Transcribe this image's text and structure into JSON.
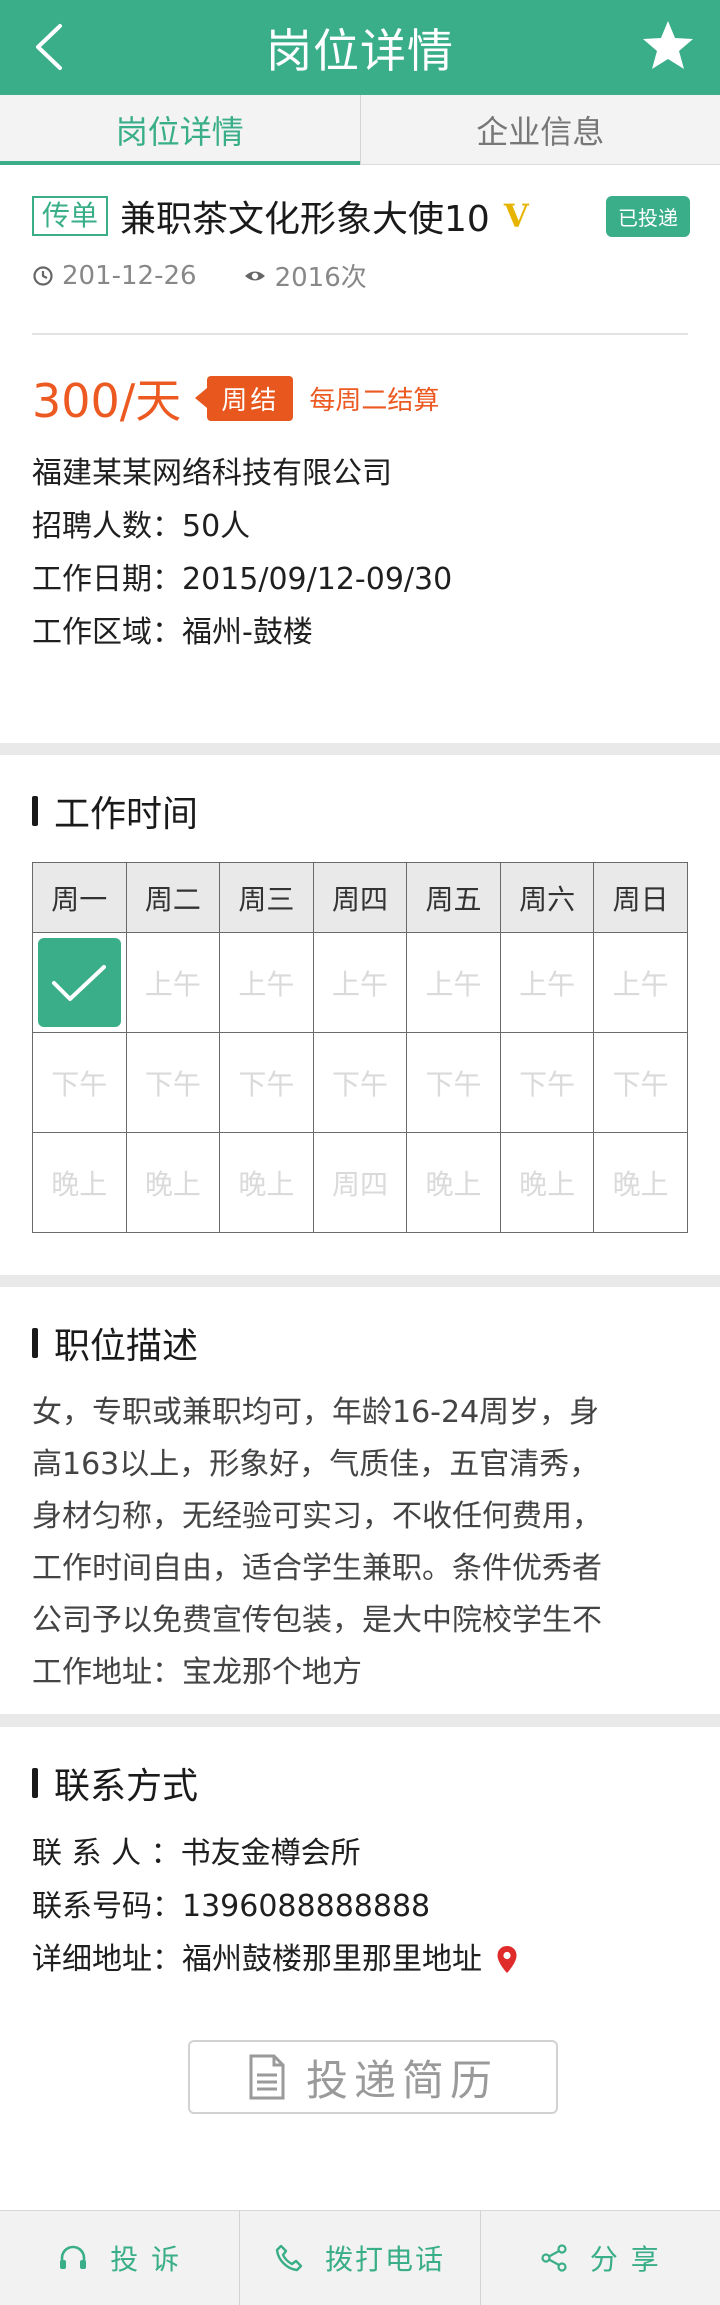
{
  "header": {
    "title": "岗位详情",
    "back_icon": "chevron-left-icon",
    "favorite_icon": "star-icon"
  },
  "tabs": [
    {
      "label": "岗位详情",
      "active": true
    },
    {
      "label": "企业信息",
      "active": false
    }
  ],
  "job": {
    "type_tag": "传单",
    "name": "兼职茶文化形象大使10",
    "verified_mark": "V",
    "applied_badge": "已投递",
    "date": "201-12-26",
    "views": "2016次",
    "salary": "300/天",
    "settle_tag": "周结",
    "settle_note": "每周二结算",
    "company": "福建某某网络科技有限公司",
    "headcount": "招聘人数：50人",
    "work_dates": "工作日期：2015/09/12-09/30",
    "work_area": "工作区域：福州-鼓楼"
  },
  "work_time": {
    "heading": "工作时间",
    "days": [
      "周一",
      "周二",
      "周三",
      "周四",
      "周五",
      "周六",
      "周日"
    ],
    "rows": [
      [
        "",
        "上午",
        "上午",
        "上午",
        "上午",
        "上午",
        "上午"
      ],
      [
        "下午",
        "下午",
        "下午",
        "下午",
        "下午",
        "下午",
        "下午"
      ],
      [
        "晚上",
        "晚上",
        "晚上",
        "周四",
        "晚上",
        "晚上",
        "晚上"
      ]
    ],
    "selected": "周一 上午"
  },
  "description": {
    "heading": "职位描述",
    "lines": [
      "女，专职或兼职均可，年龄16-24周岁，身",
      "高163以上，形象好，气质佳，五官清秀，",
      "身材匀称，无经验可实习，不收任何费用，",
      "工作时间自由，适合学生兼职。条件优秀者",
      "公司予以免费宣传包装，是大中院校学生不",
      "工作地址：宝龙那个地方"
    ]
  },
  "contact": {
    "heading": "联系方式",
    "person": "联 系 人 ：书友金樽会所",
    "phone": "联系号码：1396088888888",
    "address": "详细地址：福州鼓楼那里那里地址",
    "apply_label": "投递简历"
  },
  "bottom_bar": {
    "report": "投 诉",
    "call": "拨打电话",
    "share": "分 享"
  },
  "colors": {
    "brand_green": "#3aae88",
    "salary_orange": "#ec5a22",
    "verified_gold": "#e6b400",
    "pin_red": "#e02b2b"
  }
}
